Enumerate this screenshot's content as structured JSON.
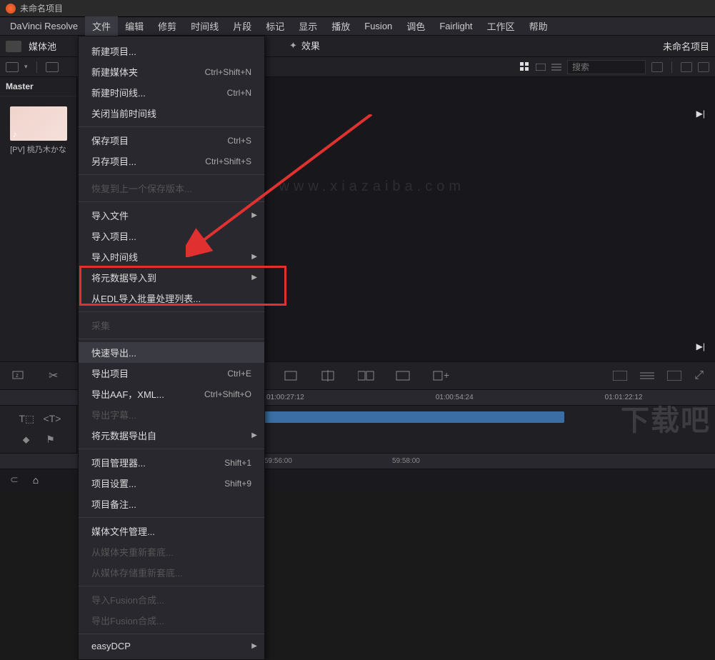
{
  "window": {
    "title": "未命名项目",
    "project_name": "未命名项目"
  },
  "menubar": [
    "DaVinci Resolve",
    "文件",
    "编辑",
    "修剪",
    "时间线",
    "片段",
    "标记",
    "显示",
    "播放",
    "Fusion",
    "调色",
    "Fairlight",
    "工作区",
    "帮助"
  ],
  "active_menu_index": 1,
  "toolbar": {
    "media_pool_label": "媒体池",
    "effects_label": "效果"
  },
  "sidebar": {
    "master_label": "Master",
    "clip_caption": "[PV] 桃乃木かな"
  },
  "subbar": {
    "search_placeholder": "搜索"
  },
  "dropdown": {
    "groups": [
      [
        {
          "label": "新建项目...",
          "shortcut": "",
          "disabled": false
        },
        {
          "label": "新建媒体夹",
          "shortcut": "Ctrl+Shift+N",
          "disabled": false
        },
        {
          "label": "新建时间线...",
          "shortcut": "Ctrl+N",
          "disabled": false
        },
        {
          "label": "关闭当前时间线",
          "shortcut": "",
          "disabled": false
        }
      ],
      [
        {
          "label": "保存项目",
          "shortcut": "Ctrl+S",
          "disabled": false
        },
        {
          "label": "另存项目...",
          "shortcut": "Ctrl+Shift+S",
          "disabled": false
        }
      ],
      [
        {
          "label": "恢复到上一个保存版本...",
          "shortcut": "",
          "disabled": true
        }
      ],
      [
        {
          "label": "导入文件",
          "shortcut": "",
          "disabled": false,
          "submenu": true
        },
        {
          "label": "导入项目...",
          "shortcut": "",
          "disabled": false
        },
        {
          "label": "导入时间线",
          "shortcut": "",
          "disabled": false,
          "submenu": true
        },
        {
          "label": "将元数据导入到",
          "shortcut": "",
          "disabled": false,
          "submenu": true
        },
        {
          "label": "从EDL导入批量处理列表...",
          "shortcut": "",
          "disabled": false
        }
      ],
      [
        {
          "label": "采集",
          "shortcut": "",
          "disabled": true
        }
      ],
      [
        {
          "label": "快速导出...",
          "shortcut": "",
          "disabled": false,
          "hover": true
        },
        {
          "label": "导出项目",
          "shortcut": "Ctrl+E",
          "disabled": false
        },
        {
          "label": "导出AAF，XML...",
          "shortcut": "Ctrl+Shift+O",
          "disabled": false
        },
        {
          "label": "导出字幕...",
          "shortcut": "",
          "disabled": true
        },
        {
          "label": "将元数据导出自",
          "shortcut": "",
          "disabled": false,
          "submenu": true
        }
      ],
      [
        {
          "label": "项目管理器...",
          "shortcut": "Shift+1",
          "disabled": false
        },
        {
          "label": "项目设置...",
          "shortcut": "Shift+9",
          "disabled": false
        },
        {
          "label": "项目备注...",
          "shortcut": "",
          "disabled": false
        }
      ],
      [
        {
          "label": "媒体文件管理...",
          "shortcut": "",
          "disabled": false
        },
        {
          "label": "从媒体夹重新套底...",
          "shortcut": "",
          "disabled": true
        },
        {
          "label": "从媒体存储重新套底...",
          "shortcut": "",
          "disabled": true
        }
      ],
      [
        {
          "label": "导入Fusion合成...",
          "shortcut": "",
          "disabled": true
        },
        {
          "label": "导出Fusion合成...",
          "shortcut": "",
          "disabled": true
        }
      ],
      [
        {
          "label": "easyDCP",
          "shortcut": "",
          "disabled": false,
          "submenu": true
        }
      ]
    ]
  },
  "timeline": {
    "timecodes": [
      "01:00:27:12",
      "01:00:54:24",
      "01:01:22:12"
    ],
    "bottom_tc": [
      "59:56:00",
      "59:58:00"
    ]
  },
  "watermark": {
    "text": "下载吧",
    "url": "www.xiazaiba.com"
  }
}
